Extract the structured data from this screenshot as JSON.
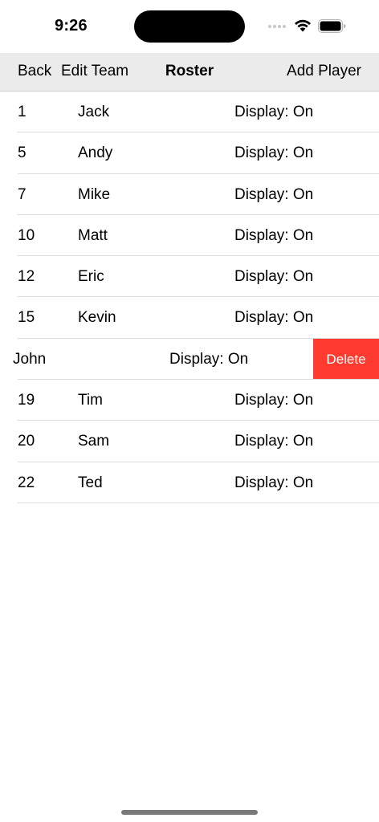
{
  "status_bar": {
    "time": "9:26",
    "icons": [
      "signal-icon",
      "wifi-icon",
      "battery-icon"
    ]
  },
  "nav": {
    "back_label": "Back",
    "edit_label": "Edit Team",
    "title": "Roster",
    "add_label": "Add Player"
  },
  "roster": {
    "rows": [
      {
        "number": "1",
        "name": "Jack",
        "display": "Display: On"
      },
      {
        "number": "5",
        "name": "Andy",
        "display": "Display: On"
      },
      {
        "number": "7",
        "name": "Mike",
        "display": "Display: On"
      },
      {
        "number": "10",
        "name": "Matt",
        "display": "Display: On"
      },
      {
        "number": "12",
        "name": "Eric",
        "display": "Display: On"
      },
      {
        "number": "15",
        "name": "Kevin",
        "display": "Display: On"
      },
      {
        "number": "",
        "name": "John",
        "display": "Display: On",
        "delete_label": "Delete"
      },
      {
        "number": "19",
        "name": "Tim",
        "display": "Display: On"
      },
      {
        "number": "20",
        "name": "Sam",
        "display": "Display: On"
      },
      {
        "number": "22",
        "name": "Ted",
        "display": "Display: On"
      }
    ]
  },
  "colors": {
    "nav_background": "#ebebeb",
    "delete_background": "#ff3b30",
    "separator": "#dcdcdc"
  }
}
